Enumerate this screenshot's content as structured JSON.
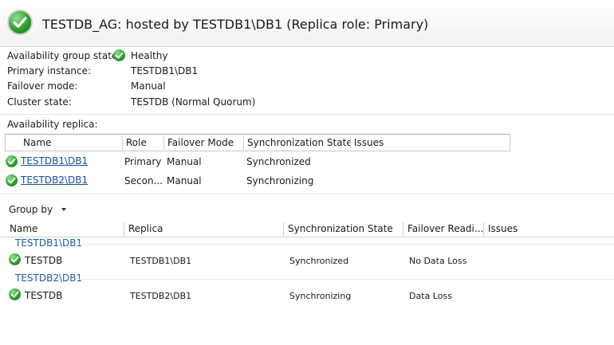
{
  "header": {
    "title": "TESTDB_AG: hosted by TESTDB1\\DB1 (Replica role: Primary)",
    "status_icon": "check-circle-icon"
  },
  "summary": {
    "ag_state_label": "Availability group state:",
    "ag_state_value": "Healthy",
    "primary_label": "Primary instance:",
    "primary_value": "TESTDB1\\DB1",
    "failover_label": "Failover mode:",
    "failover_value": "Manual",
    "cluster_label": "Cluster state:",
    "cluster_value": "TESTDB (Normal Quorum)"
  },
  "replicas": {
    "section_label": "Availability replica:",
    "columns": [
      "Name",
      "Role",
      "Failover Mode",
      "Synchronization State",
      "Issues"
    ],
    "rows": [
      {
        "name": "TESTDB1\\DB1",
        "role": "Primary",
        "failover": "Manual",
        "sync": "Synchronized",
        "issues": ""
      },
      {
        "name": "TESTDB2\\DB1",
        "role": "Secon...",
        "failover": "Manual",
        "sync": "Synchronizing",
        "issues": ""
      }
    ]
  },
  "databases": {
    "group_by_label": "Group by",
    "columns": [
      "Name",
      "Replica",
      "Synchronization State",
      "Failover Readi...",
      "Issues"
    ],
    "groups": [
      {
        "label": "TESTDB1\\DB1",
        "rows": [
          {
            "name": "TESTDB",
            "replica": "TESTDB1\\DB1",
            "sync": "Synchronized",
            "readiness": "No Data Loss",
            "issues": ""
          }
        ]
      },
      {
        "label": "TESTDB2\\DB1",
        "rows": [
          {
            "name": "TESTDB",
            "replica": "TESTDB2\\DB1",
            "sync": "Synchronizing",
            "readiness": "Data Loss",
            "issues": ""
          }
        ]
      }
    ]
  },
  "colors": {
    "link": "#1a4fa3",
    "group_header": "#1f5da6",
    "status_green": "#2a9a2a"
  }
}
